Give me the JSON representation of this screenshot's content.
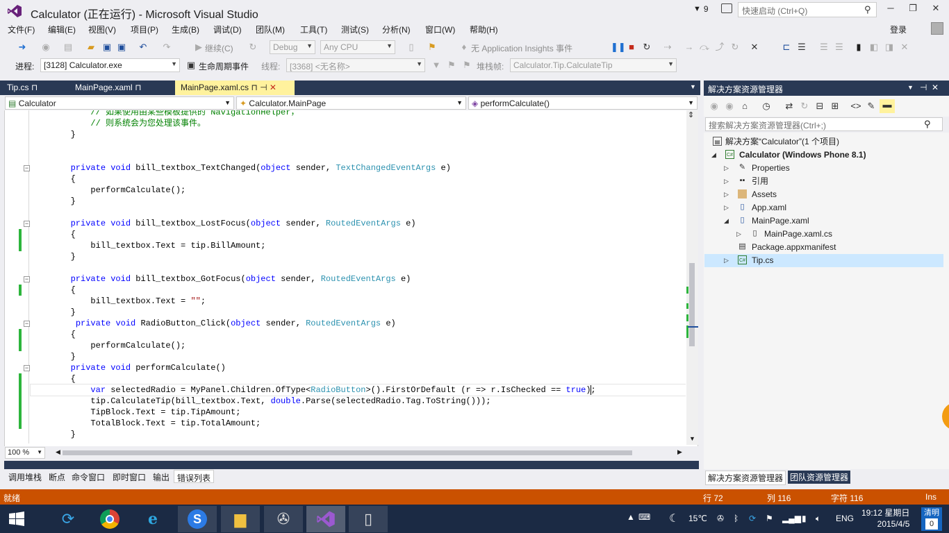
{
  "window": {
    "title": "Calculator (正在运行) - Microsoft Visual Studio",
    "notification_count": "9",
    "quick_launch_placeholder": "快速启动 (Ctrl+Q)"
  },
  "menu": [
    "文件(F)",
    "编辑(E)",
    "视图(V)",
    "项目(P)",
    "生成(B)",
    "调试(D)",
    "团队(M)",
    "工具(T)",
    "测试(S)",
    "分析(N)",
    "窗口(W)",
    "帮助(H)"
  ],
  "login": "登录",
  "toolbar": {
    "continue_label": "继续(C)",
    "config": "Debug",
    "platform": "Any CPU",
    "insights": "无 Application Insights 事件"
  },
  "debug_bar": {
    "process_label": "进程:",
    "process_value": "[3128] Calculator.exe",
    "lifecycle_label": "生命周期事件",
    "thread_label": "线程:",
    "thread_value": "[3368] <无名称>",
    "stackframe_label": "堆栈帧:",
    "stackframe_value": "Calculator.Tip.CalculateTip"
  },
  "tabs": [
    {
      "label": "Tip.cs"
    },
    {
      "label": "MainPage.xaml"
    },
    {
      "label": "MainPage.xaml.cs"
    }
  ],
  "nav": {
    "project": "Calculator",
    "class": "Calculator.MainPage",
    "member": "performCalculate()"
  },
  "code_lines": [
    "            // 如果使用由某些模板提供的 NavigationHelper，",
    "            // 则系统会为您处理该事件。",
    "        }",
    "",
    "",
    "        private void bill_textbox_TextChanged(object sender, TextChangedEventArgs e)",
    "        {",
    "            performCalculate();",
    "        }",
    "",
    "        private void bill_textbox_LostFocus(object sender, RoutedEventArgs e)",
    "        {",
    "            bill_textbox.Text = tip.BillAmount;",
    "        }",
    "",
    "        private void bill_textbox_GotFocus(object sender, RoutedEventArgs e)",
    "        {",
    "            bill_textbox.Text = \"\";",
    "        }",
    "         private void RadioButton_Click(object sender, RoutedEventArgs e)",
    "        {",
    "            performCalculate();",
    "        }",
    "        private void performCalculate()",
    "        {",
    "            var selectedRadio = MyPanel.Children.OfType<RadioButton>().FirstOrDefault (r => r.IsChecked == true);",
    "            tip.CalculateTip(bill_textbox.Text, double.Parse(selectedRadio.Tag.ToString()));",
    "            TipBlock.Text = tip.TipAmount;",
    "            TotalBlock.Text = tip.TotalAmount;",
    "        }"
  ],
  "zoom": "100 %",
  "bottom_tabs": [
    "调用堆栈",
    "断点",
    "命令窗口",
    "即时窗口",
    "输出",
    "错误列表"
  ],
  "solution_explorer": {
    "title": "解决方案资源管理器",
    "search_placeholder": "搜索解决方案资源管理器(Ctrl+;)",
    "solution": "解决方案“Calculator”(1 个项目)",
    "project": "Calculator (Windows Phone 8.1)",
    "items": [
      "Properties",
      "引用",
      "Assets",
      "App.xaml",
      "MainPage.xaml",
      "MainPage.xaml.cs",
      "Package.appxmanifest",
      "Tip.cs"
    ],
    "bottom_tabs": [
      "解决方案资源管理器",
      "团队资源管理器"
    ]
  },
  "status": {
    "ready": "就绪",
    "line": "行 72",
    "col": "列 116",
    "char": "字符 116",
    "ins": "Ins"
  },
  "taskbar": {
    "temperature": "15℃",
    "lang": "ENG",
    "time": "19:12 星期日",
    "date": "2015/4/5",
    "clear_label": "清明",
    "clear_count": "0"
  },
  "colors": {
    "accent": "#293955",
    "active_tab": "#fff29d",
    "status": "#ca5100",
    "change_marker": "#2db53c"
  }
}
